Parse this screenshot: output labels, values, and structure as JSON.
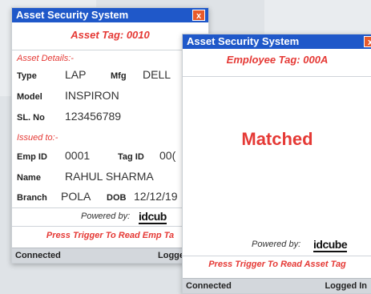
{
  "win1": {
    "title": "Asset Security System",
    "close": "x",
    "tag_title": "Asset Tag: 0010",
    "asset_details_label": "Asset Details:-",
    "type_label": "Type",
    "type_value": "LAP",
    "mfg_label": "Mfg",
    "mfg_value": "DELL",
    "model_label": "Model",
    "model_value": "INSPIRON",
    "slno_label": "SL. No",
    "slno_value": "123456789",
    "issued_label": "Issued to:-",
    "empid_label": "Emp ID",
    "empid_value": "0001",
    "tagid_label": "Tag ID",
    "tagid_value": "00(",
    "name_label": "Name",
    "name_value": "RAHUL SHARMA",
    "branch_label": "Branch",
    "branch_value": "POLA",
    "dob_label": "DOB",
    "dob_value": "12/12/19",
    "powered_by": "Powered by:",
    "logo": "idcub",
    "press_msg": "Press Trigger To Read Emp Ta",
    "status_left": "Connected",
    "status_right": "Logged"
  },
  "win2": {
    "title": "Asset Security System",
    "close": "x",
    "tag_title": "Employee Tag: 000A",
    "result": "Matched",
    "powered_by": "Powered by:",
    "logo": "idcube",
    "press_msg": "Press Trigger To Read Asset Tag",
    "status_left": "Connected",
    "status_right": "Logged In"
  },
  "colors": {
    "titlebar": "#1f58c9",
    "accent_red": "#e53935"
  }
}
